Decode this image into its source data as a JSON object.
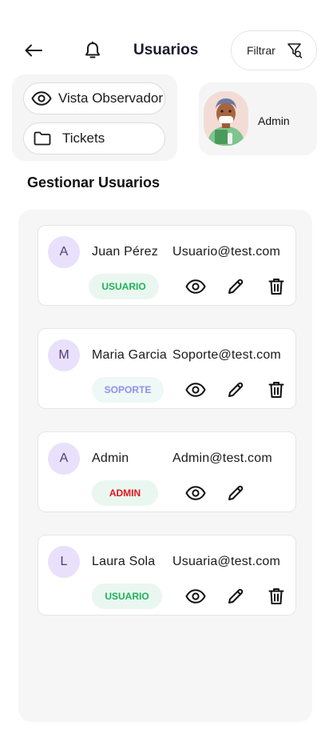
{
  "header": {
    "title": "Usuarios",
    "filter_label": "Filtrar"
  },
  "quick_actions": {
    "observer_label": "Vista Observador",
    "tickets_label": "Tickets"
  },
  "profile": {
    "name": "Admin"
  },
  "section": {
    "title": "Gestionar Usuarios"
  },
  "users": [
    {
      "initial": "A",
      "name": "Juan Pérez",
      "email": "Usuario@test.com",
      "role": "USUARIO",
      "role_color": "#1eb35a",
      "role_bg": "#eaf7f0",
      "can_delete": true
    },
    {
      "initial": "M",
      "name": "Maria Garcia",
      "email": "Soporte@test.com",
      "role": "SOPORTE",
      "role_color": "#8f8ff0",
      "role_bg": "#eef8f6",
      "can_delete": true
    },
    {
      "initial": "A",
      "name": "Admin",
      "email": "Admin@test.com",
      "role": "ADMIN",
      "role_color": "#e3141c",
      "role_bg": "#eaf7f0",
      "can_delete": false
    },
    {
      "initial": "L",
      "name": "Laura Sola",
      "email": "Usuaria@test.com",
      "role": "USUARIO",
      "role_color": "#1eb35a",
      "role_bg": "#eaf7f0",
      "can_delete": true
    }
  ],
  "icons": {
    "back": "arrow-left-icon",
    "notifications": "bell-icon",
    "filter": "filter-icon",
    "observer": "eye-icon",
    "tickets": "folder-icon",
    "view": "eye-icon",
    "edit": "pencil-icon",
    "delete": "trash-icon"
  }
}
